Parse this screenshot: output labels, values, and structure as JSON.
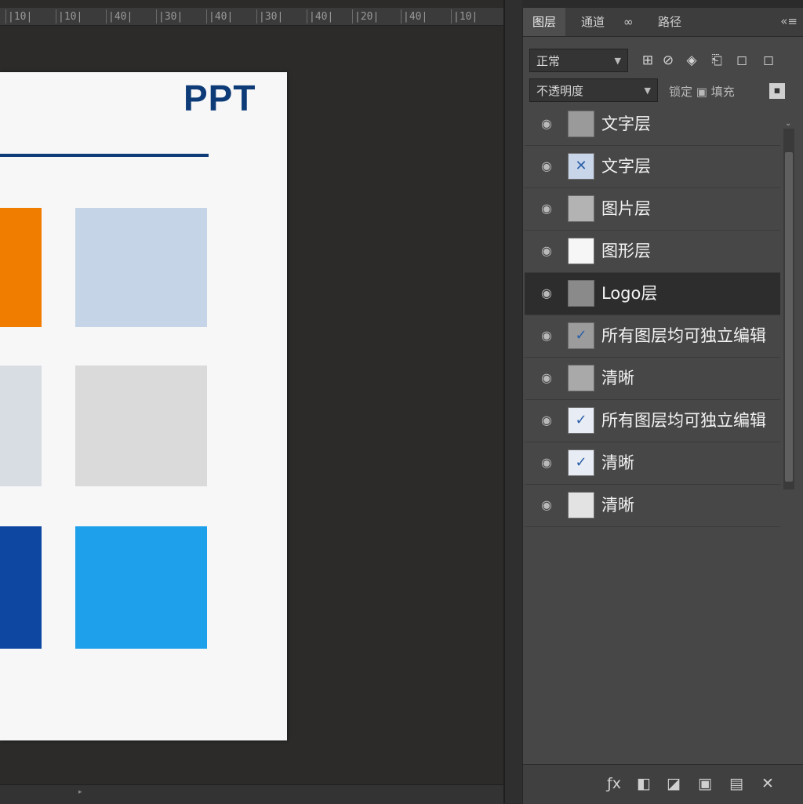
{
  "ruler": {
    "ticks": [
      "|10|",
      "|10|",
      "|40|",
      "|30|",
      "|40|",
      "|30|",
      "|40|",
      "|20|",
      "|40|",
      "|10|"
    ]
  },
  "document": {
    "title": "PPT",
    "accent_rule_color": "#0e3c7a",
    "swatches": [
      {
        "color": "#f07c00"
      },
      {
        "color": "#c5d4e6"
      },
      {
        "color": "#d8dde3"
      },
      {
        "color": "#dadada"
      },
      {
        "color": "#0d47a1"
      },
      {
        "color": "#1ea0ea"
      }
    ]
  },
  "panel": {
    "tabs": [
      {
        "label": "图层",
        "active": true
      },
      {
        "label": "通道",
        "active": false
      },
      {
        "label": "∞",
        "active": false
      },
      {
        "label": "路径",
        "active": false
      }
    ],
    "menu_icon": "«≡",
    "filter_dropdown": {
      "value": "正常"
    },
    "filter_icons": [
      "⊞",
      "⊘",
      "◈",
      "⎗",
      "◻"
    ],
    "blend_dropdown": {
      "value": "不透明度"
    },
    "fill_label": "锁定 ▣ 填充",
    "layers": [
      {
        "name": "文字层",
        "thumb": "#9a9a9a",
        "mark": "",
        "selected": false
      },
      {
        "name": "文字层",
        "thumb": "#c9d6ea",
        "mark": "✕",
        "selected": false
      },
      {
        "name": "图片层",
        "thumb": "#b3b3b3",
        "mark": "",
        "selected": false
      },
      {
        "name": "图形层",
        "thumb": "#f6f6f6",
        "mark": "",
        "selected": false
      },
      {
        "name": "Logo层",
        "thumb": "#8a8a8a",
        "mark": "",
        "selected": true
      },
      {
        "name": "所有图层均可独立编辑",
        "thumb": "#9c9c9c",
        "mark": "✓",
        "selected": false
      },
      {
        "name": "清晰",
        "thumb": "#a9a9a9",
        "mark": "",
        "selected": false
      },
      {
        "name": "所有图层均可独立编辑",
        "thumb": "#e8edf5",
        "mark": "✓",
        "selected": false
      },
      {
        "name": "清晰",
        "thumb": "#e8edf5",
        "mark": "✓",
        "selected": false
      },
      {
        "name": "清晰",
        "thumb": "#e3e3e3",
        "mark": "",
        "selected": false
      }
    ],
    "footer_icons": [
      "ƒx",
      "◧",
      "◪",
      "▣",
      "▤",
      "✕"
    ]
  }
}
